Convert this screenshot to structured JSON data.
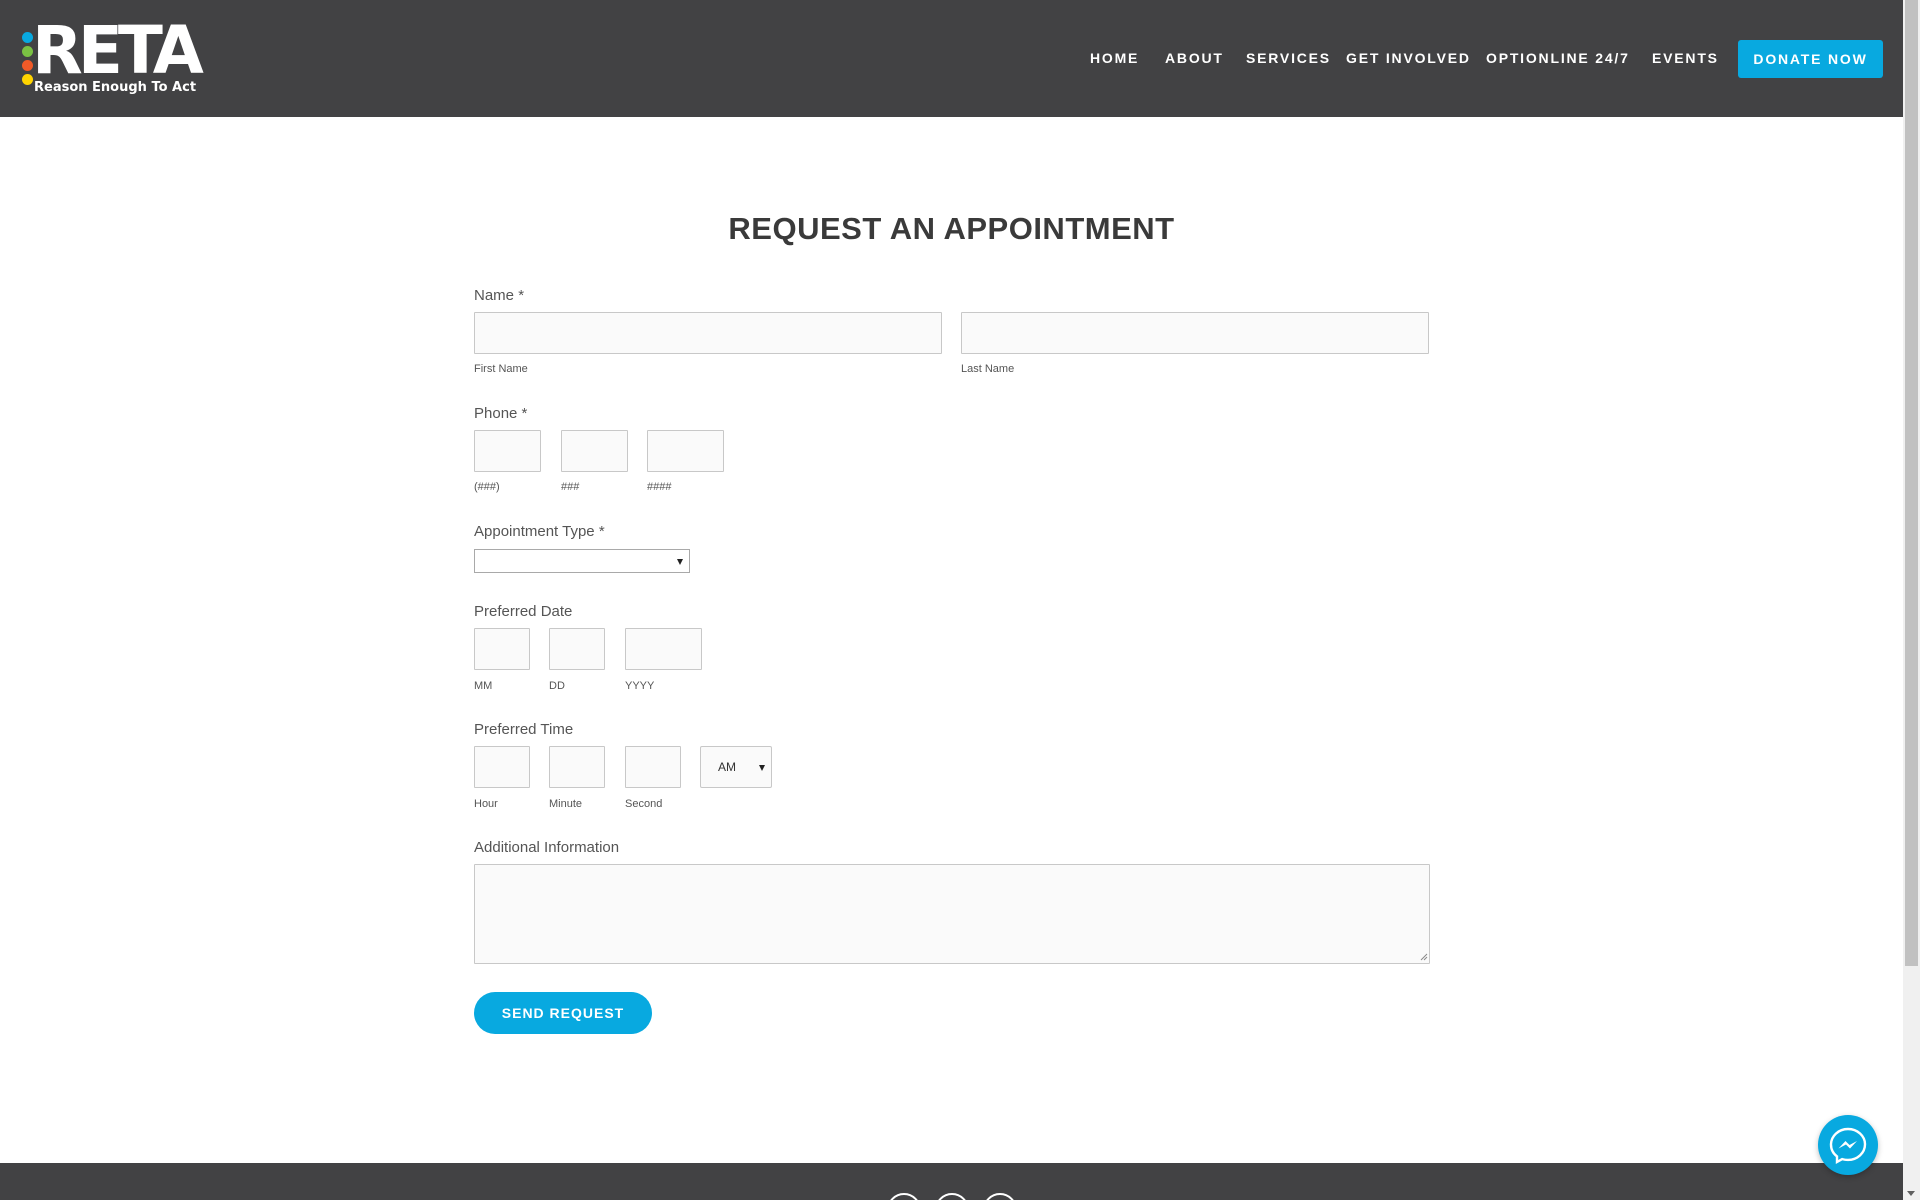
{
  "logo": {
    "word": "RETA",
    "tagline": "Reason Enough To Act",
    "dot_colors": [
      "#08a9e0",
      "#7ac143",
      "#f05a28",
      "#ffd400"
    ]
  },
  "nav": {
    "items": [
      "HOME",
      "ABOUT",
      "SERVICES",
      "GET INVOLVED",
      "OPTIONLINE 24/7",
      "EVENTS"
    ],
    "donate": "DONATE NOW"
  },
  "form": {
    "title": "REQUEST AN APPOINTMENT",
    "name": {
      "label": "Name",
      "required": "*",
      "first": "First Name",
      "last": "Last Name"
    },
    "phone": {
      "label": "Phone",
      "required": "*",
      "part1": "(###)",
      "part2": "###",
      "part3": "####"
    },
    "appointment_type": {
      "label": "Appointment Type",
      "required": "*",
      "selected": ""
    },
    "preferred_date": {
      "label": "Preferred Date",
      "mm": "MM",
      "dd": "DD",
      "yyyy": "YYYY"
    },
    "preferred_time": {
      "label": "Preferred Time",
      "hour": "Hour",
      "minute": "Minute",
      "second": "Second",
      "ampm": "AM"
    },
    "additional": {
      "label": "Additional Information"
    },
    "submit": "SEND REQUEST"
  },
  "colors": {
    "accent": "#08a9e0",
    "header_bg": "#424244"
  }
}
